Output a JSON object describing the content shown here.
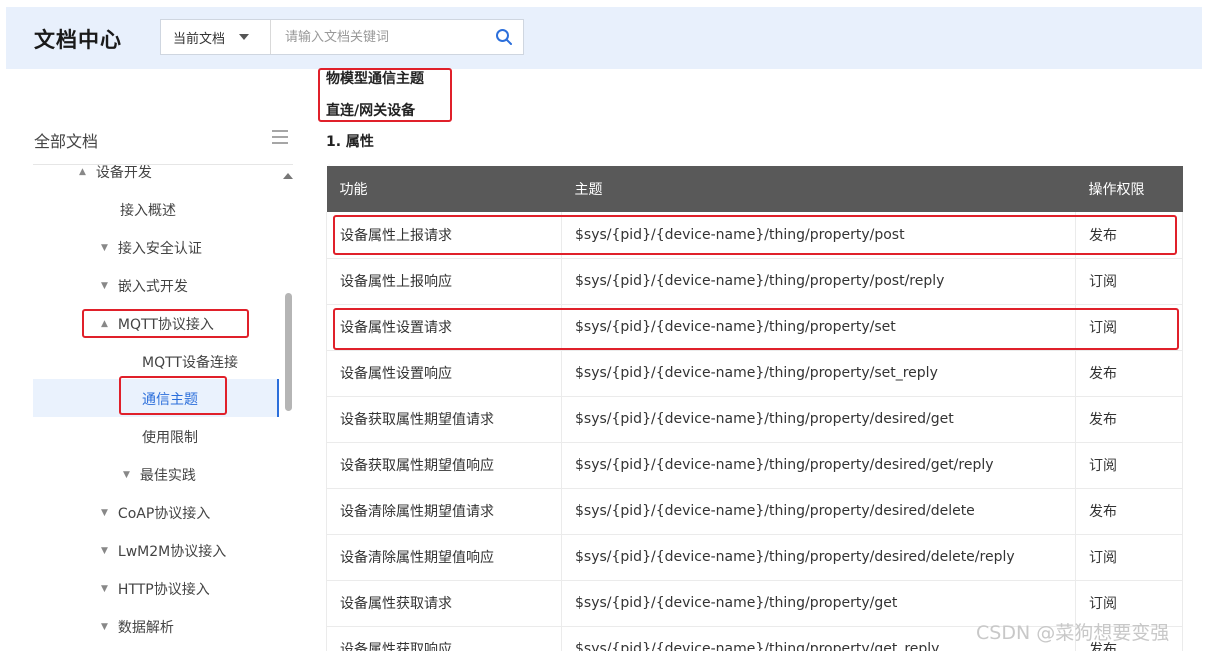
{
  "header": {
    "brand": "文档中心",
    "scope_label": "当前文档",
    "search_placeholder": "请输入文档关键词"
  },
  "sidebar": {
    "title": "全部文档",
    "items": [
      {
        "label": "设备开发",
        "expanded": true
      },
      {
        "label": "接入概述"
      },
      {
        "label": "接入安全认证",
        "expanded": false
      },
      {
        "label": "嵌入式开发",
        "expanded": false
      },
      {
        "label": "MQTT协议接入",
        "expanded": true
      },
      {
        "label": "MQTT设备连接"
      },
      {
        "label": "通信主题",
        "active": true
      },
      {
        "label": "使用限制"
      },
      {
        "label": "最佳实践",
        "expanded": false
      },
      {
        "label": "CoAP协议接入",
        "expanded": false
      },
      {
        "label": "LwM2M协议接入",
        "expanded": false
      },
      {
        "label": "HTTP协议接入",
        "expanded": false
      },
      {
        "label": "数据解析",
        "expanded": false
      }
    ]
  },
  "content": {
    "heading": "物模型通信主题",
    "subheading": "直连/网关设备",
    "section": "1. 属性",
    "table": {
      "columns": [
        "功能",
        "主题",
        "操作权限"
      ],
      "rows": [
        [
          "设备属性上报请求",
          "$sys/{pid}/{device-name}/thing/property/post",
          "发布"
        ],
        [
          "设备属性上报响应",
          "$sys/{pid}/{device-name}/thing/property/post/reply",
          "订阅"
        ],
        [
          "设备属性设置请求",
          "$sys/{pid}/{device-name}/thing/property/set",
          "订阅"
        ],
        [
          "设备属性设置响应",
          "$sys/{pid}/{device-name}/thing/property/set_reply",
          "发布"
        ],
        [
          "设备获取属性期望值请求",
          "$sys/{pid}/{device-name}/thing/property/desired/get",
          "发布"
        ],
        [
          "设备获取属性期望值响应",
          "$sys/{pid}/{device-name}/thing/property/desired/get/reply",
          "订阅"
        ],
        [
          "设备清除属性期望值请求",
          "$sys/{pid}/{device-name}/thing/property/desired/delete",
          "发布"
        ],
        [
          "设备清除属性期望值响应",
          "$sys/{pid}/{device-name}/thing/property/desired/delete/reply",
          "订阅"
        ],
        [
          "设备属性获取请求",
          "$sys/{pid}/{device-name}/thing/property/get",
          "订阅"
        ],
        [
          "设备属性获取响应",
          "$sys/{pid}/{device-name}/thing/property/get_reply",
          "发布"
        ]
      ]
    }
  },
  "watermark": "CSDN @菜狗想要变强",
  "colors": {
    "header_bg": "#e8f0fc",
    "accent": "#2c6fdb",
    "table_header_bg": "#595959",
    "annotation_red": "#e0202a"
  }
}
